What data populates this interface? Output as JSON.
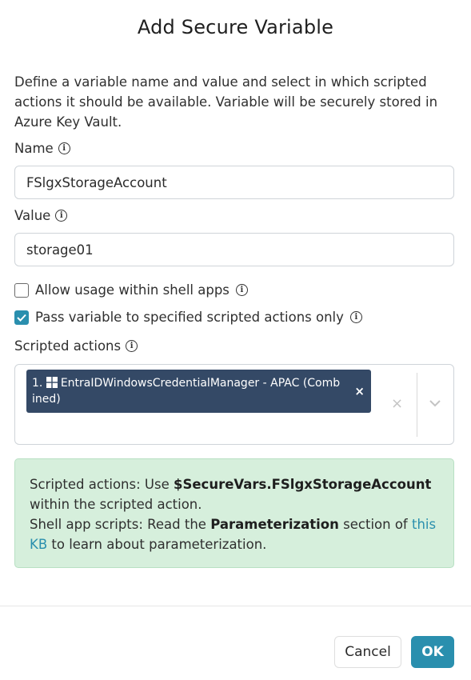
{
  "dialog": {
    "title": "Add Secure Variable",
    "description": "Define a variable name and value and select in which scripted actions it should be available. Variable will be securely stored in Azure Key Vault."
  },
  "fields": {
    "name": {
      "label": "Name",
      "value": "FSlgxStorageAccount"
    },
    "value": {
      "label": "Value",
      "value": "storage01"
    }
  },
  "options": {
    "allow_shell_apps": {
      "label": "Allow usage within shell apps",
      "checked": false
    },
    "pass_to_specified": {
      "label": "Pass variable to specified scripted actions only",
      "checked": true
    }
  },
  "scripted_actions": {
    "label": "Scripted actions",
    "selected": [
      {
        "index": "1.",
        "name": "EntraIDWindowsCredentialManager - APAC (Comb",
        "name_cont": "ined)"
      }
    ],
    "clear_symbol": "×",
    "remove_symbol": "×"
  },
  "info_panel": {
    "line1_prefix": "Scripted actions: Use ",
    "line1_var": "$SecureVars.FSlgxStorageAccount",
    "line1_suffix": " within the scripted action.",
    "line2_prefix": "Shell app scripts: Read the ",
    "line2_bold": "Parameterization",
    "line2_mid": " section of ",
    "line2_link": "this KB",
    "line2_suffix": " to learn about parameterization."
  },
  "footer": {
    "cancel_label": "Cancel",
    "ok_label": "OK"
  },
  "colors": {
    "accent": "#2a8fae",
    "chip_bg": "#344966",
    "info_bg": "#d6efdc"
  },
  "icons": [
    "info-icon",
    "windows-icon",
    "check-icon",
    "chevron-down-icon",
    "close-icon"
  ]
}
